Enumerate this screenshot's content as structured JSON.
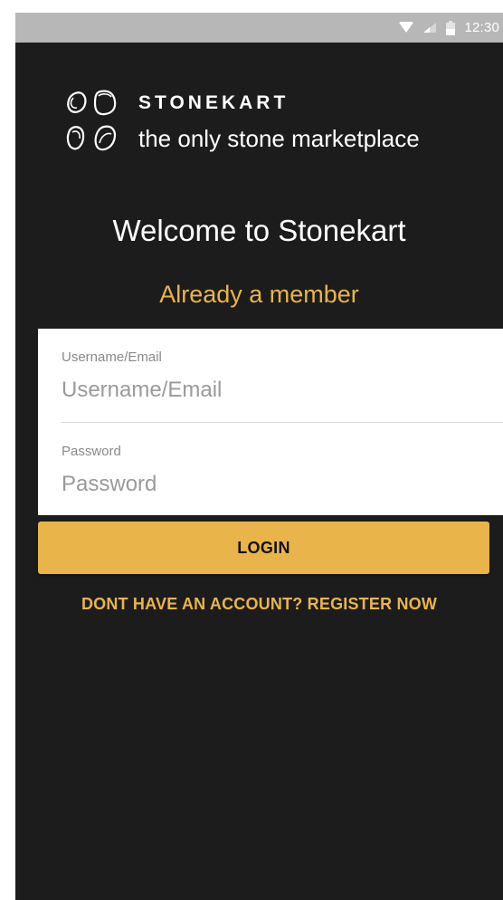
{
  "status_bar": {
    "time": "12:30",
    "icons": [
      "wifi-icon",
      "signal-icon",
      "battery-icon"
    ]
  },
  "logo": {
    "brand": "STONEKART",
    "tagline": "the only stone marketplace",
    "icon": "stones-logo-icon"
  },
  "welcome_title": "Welcome to Stonekart",
  "member_heading": "Already a member",
  "form": {
    "username": {
      "label": "Username/Email",
      "placeholder": "Username/Email",
      "value": ""
    },
    "password": {
      "label": "Password",
      "placeholder": "Password",
      "value": ""
    }
  },
  "login_button": "LOGIN",
  "register_link": "DONT HAVE AN ACCOUNT? REGISTER NOW",
  "colors": {
    "background": "#1c1c1c",
    "accent": "#e9b54a",
    "status_bar": "#b7b7b7",
    "form_background": "#ffffff"
  }
}
